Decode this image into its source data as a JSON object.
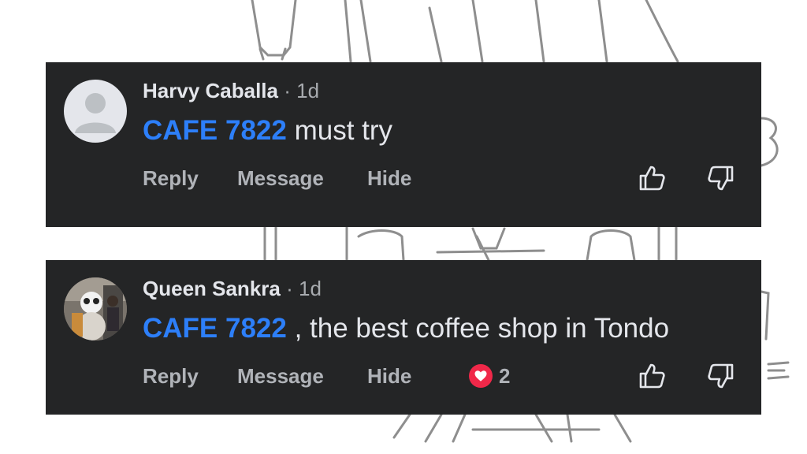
{
  "comments": [
    {
      "author": "Harvy Caballa",
      "separator": "·",
      "time": "1d",
      "mention": "CAFE 7822",
      "text": " must try",
      "actions": {
        "reply": "Reply",
        "message": "Message",
        "hide": "Hide"
      },
      "avatar": "default-avatar-icon"
    },
    {
      "author": "Queen Sankra",
      "separator": "·",
      "time": "1d",
      "mention": "CAFE 7822",
      "text": " , the best coffee shop in Tondo",
      "actions": {
        "reply": "Reply",
        "message": "Message",
        "hide": "Hide"
      },
      "reaction": {
        "icon": "heart-icon",
        "count": "2",
        "color": "#f02849"
      },
      "avatar": "photo-avatar"
    }
  ],
  "colors": {
    "card_bg": "#242526",
    "mention": "#2d7ff9",
    "primary_text": "#e4e6eb",
    "secondary_text": "#b0b3b8"
  }
}
